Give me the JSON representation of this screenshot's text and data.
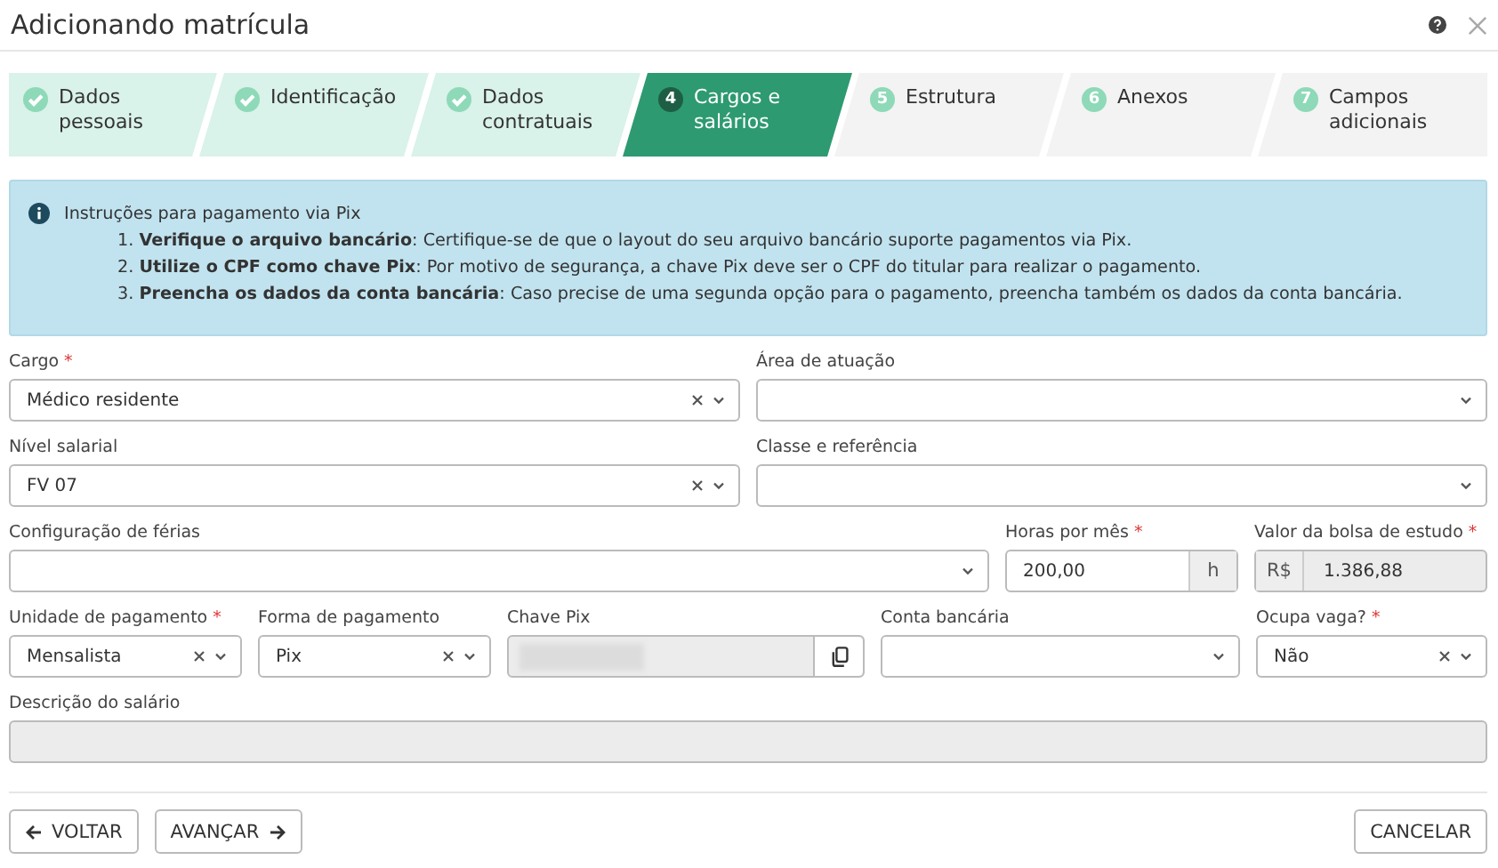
{
  "window": {
    "title": "Adicionando matrícula"
  },
  "steps": [
    {
      "label": "Dados pessoais",
      "completed": true,
      "selected": false
    },
    {
      "label": "Identificação",
      "completed": true,
      "selected": false
    },
    {
      "label": "Dados contratuais",
      "completed": true,
      "selected": false
    },
    {
      "number": "4",
      "label": "Cargos e salários",
      "completed": false,
      "selected": true
    },
    {
      "number": "5",
      "label": "Estrutura",
      "completed": false,
      "selected": false
    },
    {
      "number": "6",
      "label": "Anexos",
      "completed": false,
      "selected": false
    },
    {
      "number": "7",
      "label": "Campos adicionais",
      "completed": false,
      "selected": false
    }
  ],
  "info": {
    "title": "Instruções para pagamento via Pix",
    "items": [
      "1. **Verifique o arquivo bancário**: Certifique-se de que o layout do seu arquivo bancário suporte pagamentos via Pix.",
      "2. **Utilize o CPF como chave Pix**: Por motivo de segurança, a chave Pix deve ser o CPF do titular para realizar o pagamento.",
      "3. **Preencha os dados da conta bancária**: Caso precise de uma segunda opção para o pagamento, preencha também os dados da conta bancária."
    ]
  },
  "rows": [
    [
      {
        "label": "Cargo",
        "required_mark": "*",
        "kind": "select",
        "value": "Médico residente",
        "clearable": true
      },
      {
        "label": "Área de atuação",
        "kind": "select",
        "clearable": false
      }
    ],
    [
      {
        "label": "Nível salarial",
        "kind": "select",
        "value": "FV 07",
        "clearable": true
      },
      {
        "label": "Classe e referência",
        "kind": "select",
        "clearable": false
      }
    ],
    [
      {
        "label": "Configuração de férias",
        "kind": "select",
        "clearable": false
      },
      {
        "label": "Horas por mês",
        "required_mark": "*",
        "kind": "suffix",
        "value": "200,00",
        "addon": "h"
      },
      {
        "label": "Valor da bolsa de estudo",
        "required_mark": "*",
        "kind": "prefix",
        "value": "1.386,88",
        "addon": "R$"
      }
    ],
    [
      {
        "label": "Unidade de pagamento",
        "required_mark": "*",
        "kind": "select",
        "value": "Mensalista",
        "clearable": true
      },
      {
        "label": "Forma de pagamento",
        "kind": "select",
        "value": "Pix",
        "clearable": true
      },
      {
        "label": "Chave Pix",
        "kind": "masked"
      },
      {
        "label": "Conta bancária",
        "kind": "select",
        "clearable": false
      },
      {
        "label": "Ocupa vaga?",
        "required_mark": "*",
        "kind": "select",
        "value": "Não",
        "clearable": true
      }
    ],
    [
      {
        "label": "Descrição do salário",
        "kind": "textarea"
      }
    ]
  ],
  "footer": {
    "back": "VOLTAR",
    "next": "AVANÇAR",
    "cancel": "CANCELAR"
  }
}
